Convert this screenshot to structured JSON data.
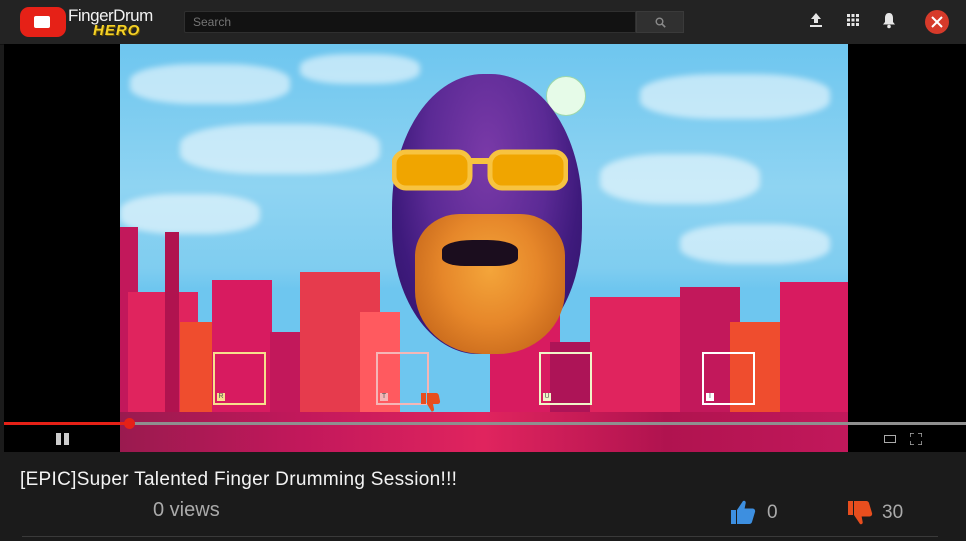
{
  "header": {
    "logo_line1": "FingerDrum",
    "logo_line2": "HERO",
    "search_placeholder": "Search",
    "icons": [
      "upload-icon",
      "apps-grid-icon",
      "notifications-bell-icon",
      "close-icon"
    ]
  },
  "player": {
    "target_keys": [
      "R",
      "T",
      "U",
      "I"
    ],
    "target_colors": [
      "#f7e08c",
      "#f5b6b6",
      "#f0f5c8",
      "#ffffff"
    ],
    "progress_fraction": 0.13,
    "state": "playing",
    "accent_color": "#e62117"
  },
  "video": {
    "title": "[EPIC]Super Talented Finger Drumming Session!!!",
    "views": "0 views",
    "likes": "0",
    "dislikes": "30",
    "like_color": "#3d8fe0",
    "dislike_color": "#e84e1e"
  }
}
